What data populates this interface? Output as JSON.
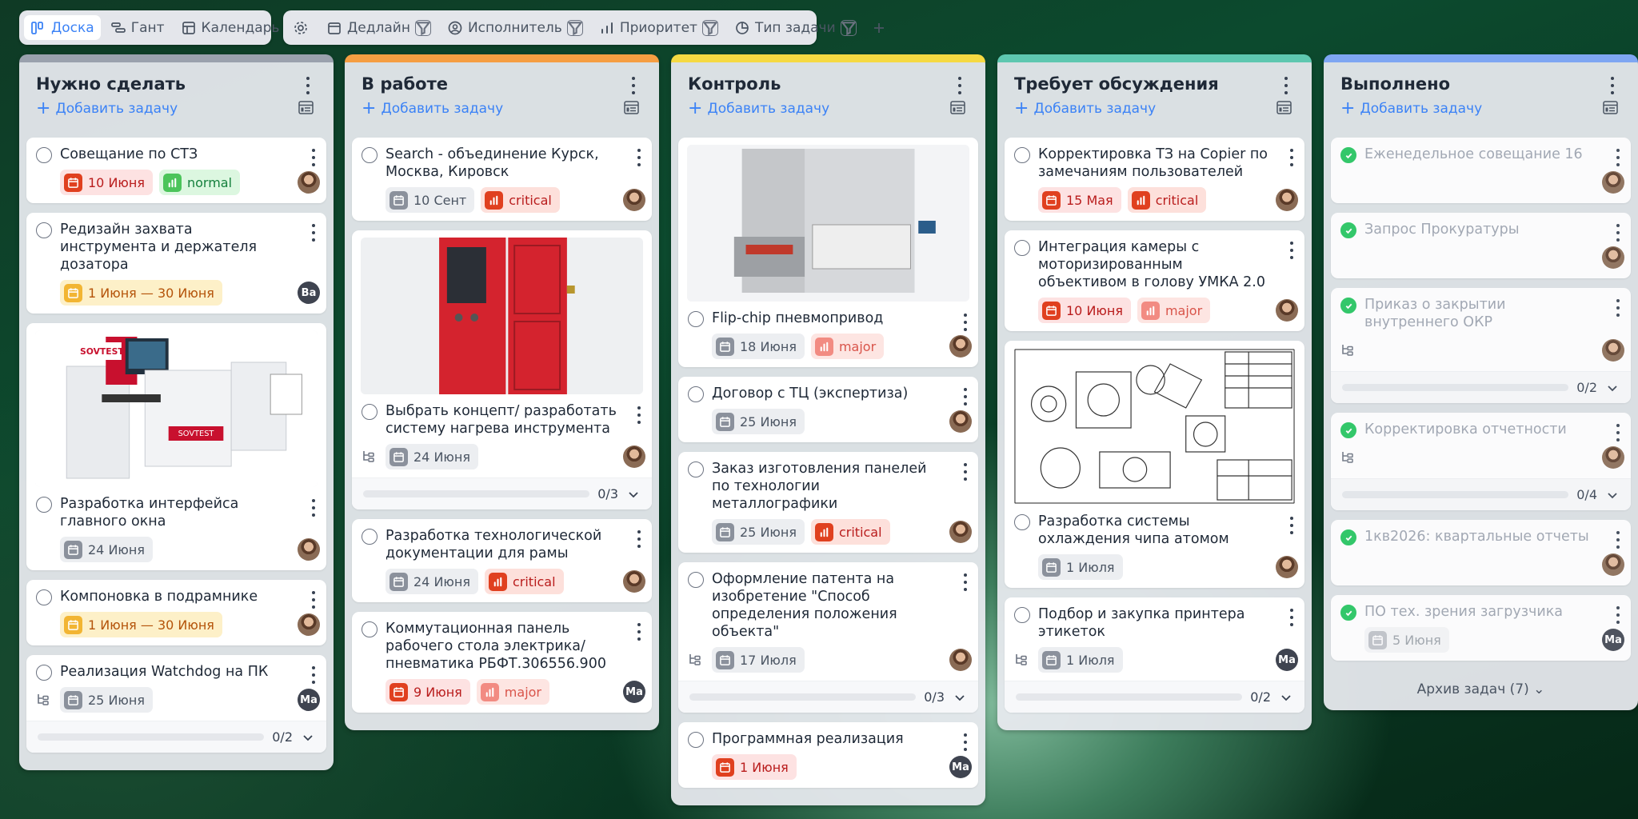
{
  "views": [
    {
      "label": "Доска",
      "active": true
    },
    {
      "label": "Гант"
    },
    {
      "label": "Календарь"
    }
  ],
  "filters": [
    "Дедлайн",
    "Исполнитель",
    "Приоритет",
    "Тип задачи"
  ],
  "add_task": "Добавить задачу",
  "columns": [
    {
      "title": "Нужно сделать",
      "color": "#9aa1ad",
      "cards": [
        {
          "title": "Совещание по СТЗ",
          "date": "10 Июня",
          "priority": "normal",
          "avatar": "photo"
        },
        {
          "title": "Редизайн захвата инструмента и держателя дозатора",
          "date": "1 Июня — 30 Июня",
          "avatar": "Ва"
        },
        {
          "title": "Разработка интерфейса главного окна",
          "date": "24 Июня",
          "avatar": "photo",
          "image": "machine-sovtest-ft17"
        },
        {
          "title": "Компоновка в подрамнике",
          "date": "1 Июня — 30 Июня",
          "avatar": "photo"
        },
        {
          "title": "Реализация Watchdog на ПК",
          "date": "25 Июня",
          "avatar": "Ма",
          "progress": "0/2"
        }
      ]
    },
    {
      "title": "В работе",
      "color": "#f59e42",
      "cards": [
        {
          "title": "Search - объединение Курск, Москва, Кировск",
          "date": "10 Сент",
          "priority": "critical",
          "avatar": "photo"
        },
        {
          "title": "Выбрать концепт/ разработать систему нагрева инструмента",
          "date": "24 Июня",
          "avatar": "photo",
          "progress": "0/3",
          "image": "red-cabinet"
        },
        {
          "title": "Разработка технологической документации для рамы",
          "date": "24 Июня",
          "priority": "critical",
          "avatar": "photo"
        },
        {
          "title": "Коммутационная панель рабочего стола электрика/ пневматика РБФТ.306556.900",
          "date": "9 Июня",
          "priority": "major",
          "avatar": "Ма"
        }
      ]
    },
    {
      "title": "Контроль",
      "color": "#f5d942",
      "cards": [
        {
          "title": "Flip-chip пневмопривод",
          "date": "18 Июня",
          "priority": "major",
          "avatar": "photo",
          "image": "gray-machine"
        },
        {
          "title": "Договор с ТЦ (экспертиза)",
          "date": "25 Июня",
          "avatar": "photo"
        },
        {
          "title": "Заказ изготовления панелей по технологии металлографики",
          "date": "25 Июня",
          "priority": "critical",
          "avatar": "photo"
        },
        {
          "title": "Оформление патента на изобретение \"Способ определения положения объекта\"",
          "date": "17 Июля",
          "avatar": "photo",
          "progress": "0/3"
        },
        {
          "title": "Программная реализация",
          "date": "1 Июня",
          "avatar": "Ма"
        }
      ]
    },
    {
      "title": "Требует обсуждения",
      "color": "#5ec7b0",
      "cards": [
        {
          "title": "Корректировка ТЗ на Copier по замечаниям пользователей",
          "date": "15 Мая",
          "priority": "critical",
          "avatar": "photo"
        },
        {
          "title": "Интеграция камеры с моторизированным объективом в голову УМКА 2.0",
          "date": "10 Июня",
          "priority": "major",
          "avatar": "photo"
        },
        {
          "title": "Разработка системы охлаждения чипа атомом",
          "date": "1 Июля",
          "avatar": "photo",
          "image": "drawing"
        },
        {
          "title": "Подбор и закупка принтера этикеток",
          "date": "1 Июля",
          "avatar": "Ма",
          "progress": "0/2"
        }
      ]
    },
    {
      "title": "Выполнено",
      "color": "#7ea6f2",
      "cards": [
        {
          "title": "Еженедельное совещание 16",
          "avatar": "photo"
        },
        {
          "title": "Запрос Прокуратуры",
          "avatar": "photo"
        },
        {
          "title": "Приказ о закрытии внутреннего ОКР",
          "avatar": "photo",
          "progress": "0/2"
        },
        {
          "title": "Корректировка отчетности",
          "avatar": "photo",
          "progress": "0/4"
        },
        {
          "title": "1кв2026: квартальные отчеты",
          "avatar": "photo"
        },
        {
          "title": "ПО тех. зрения загрузчика",
          "date": "5 Июня",
          "avatar": "Ма"
        }
      ],
      "archive": "Архив задач (7)"
    }
  ]
}
